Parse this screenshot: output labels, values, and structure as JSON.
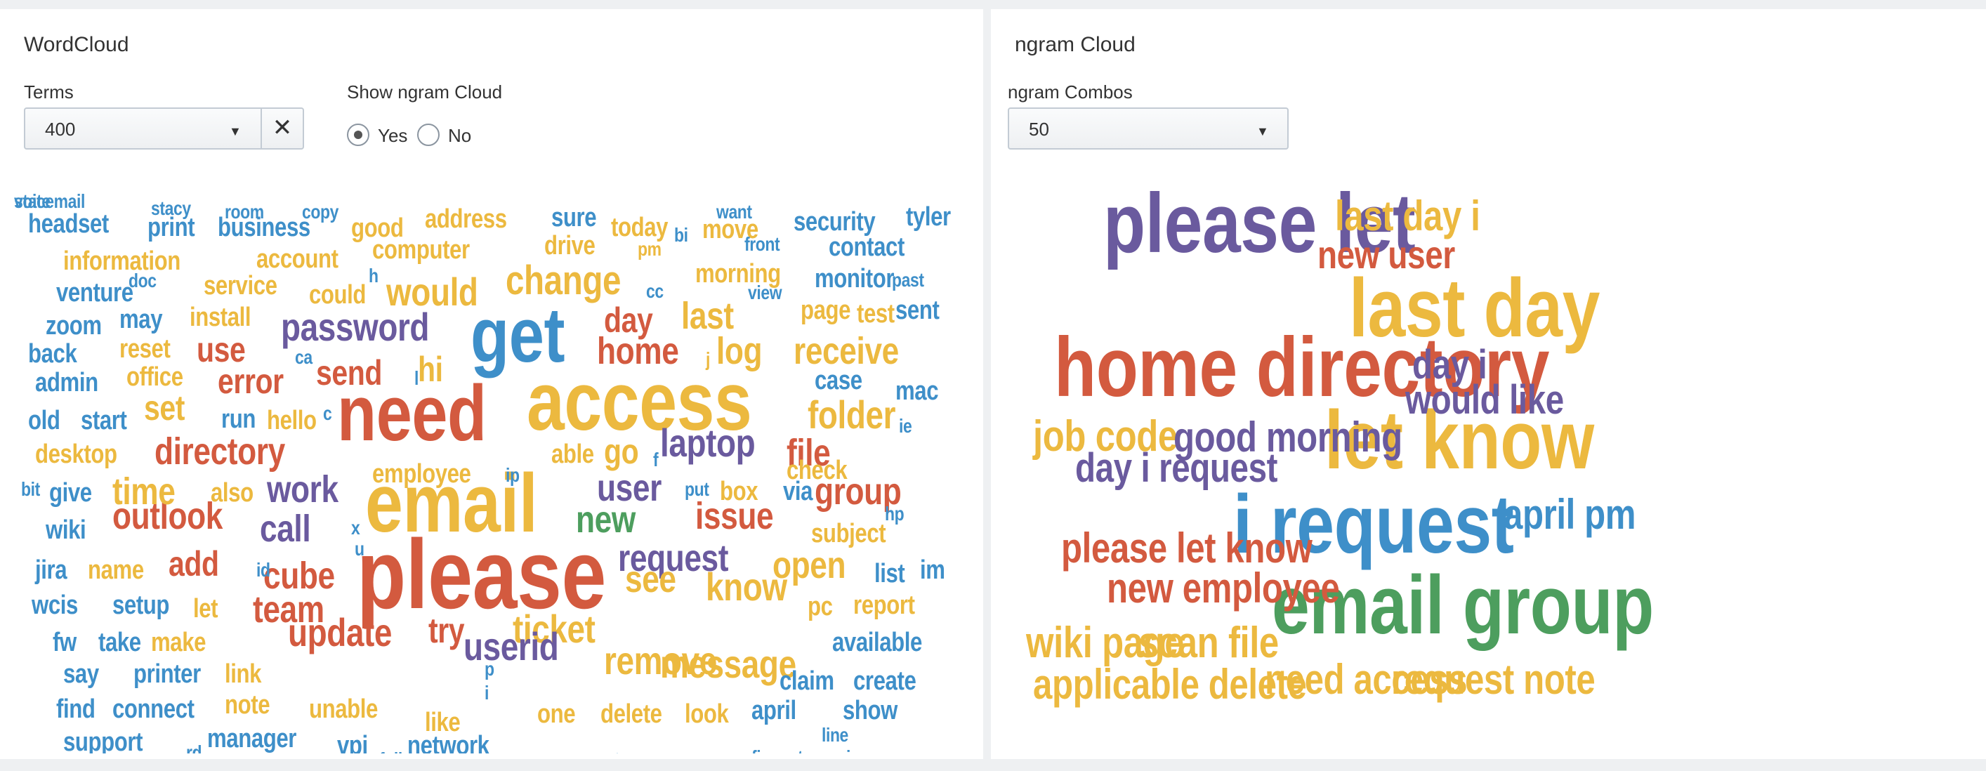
{
  "colors": {
    "blue": "#3e8fc9",
    "yellow": "#ecb93f",
    "red": "#d35a3f",
    "purple": "#6a5a9e",
    "green": "#4d9e5e"
  },
  "left_panel": {
    "title": "WordCloud",
    "terms": {
      "label": "Terms",
      "value": "400"
    },
    "show_ngram": {
      "label": "Show ngram Cloud",
      "options": [
        {
          "label": "Yes",
          "selected": true
        },
        {
          "label": "No",
          "selected": false
        }
      ]
    }
  },
  "right_panel": {
    "title": "ngram Cloud",
    "ngram_combos": {
      "label": "ngram Combos",
      "value": "50"
    }
  },
  "word_cloud": {
    "words": [
      {
        "t": "please",
        "c": "red",
        "s": 140
      },
      {
        "t": "access",
        "c": "yellow",
        "s": 118
      },
      {
        "t": "email",
        "c": "yellow",
        "s": 118
      },
      {
        "t": "need",
        "c": "red",
        "s": 112
      },
      {
        "t": "get",
        "c": "blue",
        "s": 110
      },
      {
        "t": "password",
        "c": "purple",
        "s": 56
      },
      {
        "t": "change",
        "c": "yellow",
        "s": 58
      },
      {
        "t": "would",
        "c": "yellow",
        "s": 56
      },
      {
        "t": "home",
        "c": "red",
        "s": 54
      },
      {
        "t": "receive",
        "c": "yellow",
        "s": 54
      },
      {
        "t": "folder",
        "c": "yellow",
        "s": 56
      },
      {
        "t": "directory",
        "c": "red",
        "s": 54
      },
      {
        "t": "laptop",
        "c": "purple",
        "s": 56
      },
      {
        "t": "remove",
        "c": "yellow",
        "s": 56
      },
      {
        "t": "message",
        "c": "yellow",
        "s": 56
      },
      {
        "t": "ticket",
        "c": "yellow",
        "s": 56
      },
      {
        "t": "userid",
        "c": "purple",
        "s": 56
      },
      {
        "t": "update",
        "c": "red",
        "s": 56
      },
      {
        "t": "outlook",
        "c": "red",
        "s": 54
      },
      {
        "t": "cube",
        "c": "red",
        "s": 54
      },
      {
        "t": "team",
        "c": "red",
        "s": 54
      },
      {
        "t": "time",
        "c": "yellow",
        "s": 54
      },
      {
        "t": "work",
        "c": "purple",
        "s": 54
      },
      {
        "t": "call",
        "c": "purple",
        "s": 54
      },
      {
        "t": "group",
        "c": "red",
        "s": 54
      },
      {
        "t": "issue",
        "c": "red",
        "s": 54
      },
      {
        "t": "request",
        "c": "purple",
        "s": 54
      },
      {
        "t": "know",
        "c": "yellow",
        "s": 56
      },
      {
        "t": "open",
        "c": "yellow",
        "s": 54
      },
      {
        "t": "see",
        "c": "yellow",
        "s": 54
      },
      {
        "t": "last",
        "c": "yellow",
        "s": 54
      },
      {
        "t": "log",
        "c": "yellow",
        "s": 54
      },
      {
        "t": "file",
        "c": "red",
        "s": 54
      },
      {
        "t": "user",
        "c": "purple",
        "s": 54
      },
      {
        "t": "new",
        "c": "green",
        "s": 54
      },
      {
        "t": "error",
        "c": "red",
        "s": 50
      },
      {
        "t": "send",
        "c": "red",
        "s": 50
      },
      {
        "t": "use",
        "c": "red",
        "s": 50
      },
      {
        "t": "set",
        "c": "yellow",
        "s": 50
      },
      {
        "t": "day",
        "c": "red",
        "s": 50
      },
      {
        "t": "add",
        "c": "red",
        "s": 50
      },
      {
        "t": "try",
        "c": "red",
        "s": 50
      },
      {
        "t": "go",
        "c": "yellow",
        "s": 50
      },
      {
        "t": "hi",
        "c": "yellow",
        "s": 50
      },
      {
        "t": "headset",
        "c": "blue",
        "s": 38
      },
      {
        "t": "print",
        "c": "blue",
        "s": 38
      },
      {
        "t": "business",
        "c": "blue",
        "s": 38
      },
      {
        "t": "good",
        "c": "yellow",
        "s": 38
      },
      {
        "t": "address",
        "c": "yellow",
        "s": 38
      },
      {
        "t": "sure",
        "c": "blue",
        "s": 38
      },
      {
        "t": "today",
        "c": "yellow",
        "s": 38
      },
      {
        "t": "move",
        "c": "yellow",
        "s": 38
      },
      {
        "t": "security",
        "c": "blue",
        "s": 38
      },
      {
        "t": "tyler",
        "c": "blue",
        "s": 38
      },
      {
        "t": "information",
        "c": "yellow",
        "s": 38
      },
      {
        "t": "account",
        "c": "yellow",
        "s": 38
      },
      {
        "t": "computer",
        "c": "yellow",
        "s": 38
      },
      {
        "t": "drive",
        "c": "yellow",
        "s": 38
      },
      {
        "t": "contact",
        "c": "blue",
        "s": 38
      },
      {
        "t": "venture",
        "c": "blue",
        "s": 38
      },
      {
        "t": "service",
        "c": "yellow",
        "s": 38
      },
      {
        "t": "could",
        "c": "yellow",
        "s": 38
      },
      {
        "t": "morning",
        "c": "yellow",
        "s": 38
      },
      {
        "t": "monitor",
        "c": "blue",
        "s": 38
      },
      {
        "t": "zoom",
        "c": "blue",
        "s": 38
      },
      {
        "t": "may",
        "c": "blue",
        "s": 38
      },
      {
        "t": "install",
        "c": "yellow",
        "s": 38
      },
      {
        "t": "page",
        "c": "yellow",
        "s": 38
      },
      {
        "t": "test",
        "c": "yellow",
        "s": 38
      },
      {
        "t": "sent",
        "c": "blue",
        "s": 38
      },
      {
        "t": "back",
        "c": "blue",
        "s": 38
      },
      {
        "t": "reset",
        "c": "yellow",
        "s": 38
      },
      {
        "t": "admin",
        "c": "blue",
        "s": 38
      },
      {
        "t": "office",
        "c": "yellow",
        "s": 38
      },
      {
        "t": "case",
        "c": "blue",
        "s": 38
      },
      {
        "t": "mac",
        "c": "blue",
        "s": 38
      },
      {
        "t": "old",
        "c": "blue",
        "s": 38
      },
      {
        "t": "start",
        "c": "blue",
        "s": 38
      },
      {
        "t": "run",
        "c": "blue",
        "s": 38
      },
      {
        "t": "hello",
        "c": "yellow",
        "s": 38
      },
      {
        "t": "desktop",
        "c": "yellow",
        "s": 38
      },
      {
        "t": "employee",
        "c": "yellow",
        "s": 38
      },
      {
        "t": "able",
        "c": "yellow",
        "s": 38
      },
      {
        "t": "check",
        "c": "yellow",
        "s": 38
      },
      {
        "t": "give",
        "c": "blue",
        "s": 38
      },
      {
        "t": "also",
        "c": "yellow",
        "s": 38
      },
      {
        "t": "box",
        "c": "yellow",
        "s": 38
      },
      {
        "t": "via",
        "c": "blue",
        "s": 38
      },
      {
        "t": "wiki",
        "c": "blue",
        "s": 38
      },
      {
        "t": "subject",
        "c": "yellow",
        "s": 38
      },
      {
        "t": "jira",
        "c": "blue",
        "s": 38
      },
      {
        "t": "name",
        "c": "yellow",
        "s": 38
      },
      {
        "t": "list",
        "c": "blue",
        "s": 38
      },
      {
        "t": "im",
        "c": "blue",
        "s": 38
      },
      {
        "t": "wcis",
        "c": "blue",
        "s": 38
      },
      {
        "t": "setup",
        "c": "blue",
        "s": 38
      },
      {
        "t": "let",
        "c": "yellow",
        "s": 38
      },
      {
        "t": "pc",
        "c": "yellow",
        "s": 38
      },
      {
        "t": "report",
        "c": "yellow",
        "s": 38
      },
      {
        "t": "fw",
        "c": "blue",
        "s": 38
      },
      {
        "t": "take",
        "c": "blue",
        "s": 38
      },
      {
        "t": "make",
        "c": "yellow",
        "s": 38
      },
      {
        "t": "available",
        "c": "blue",
        "s": 38
      },
      {
        "t": "say",
        "c": "blue",
        "s": 38
      },
      {
        "t": "printer",
        "c": "blue",
        "s": 38
      },
      {
        "t": "link",
        "c": "yellow",
        "s": 38
      },
      {
        "t": "note",
        "c": "yellow",
        "s": 38
      },
      {
        "t": "claim",
        "c": "blue",
        "s": 38
      },
      {
        "t": "create",
        "c": "blue",
        "s": 38
      },
      {
        "t": "find",
        "c": "blue",
        "s": 38
      },
      {
        "t": "connect",
        "c": "blue",
        "s": 38
      },
      {
        "t": "unable",
        "c": "yellow",
        "s": 38
      },
      {
        "t": "like",
        "c": "yellow",
        "s": 38
      },
      {
        "t": "one",
        "c": "yellow",
        "s": 38
      },
      {
        "t": "april",
        "c": "blue",
        "s": 38
      },
      {
        "t": "show",
        "c": "blue",
        "s": 38
      },
      {
        "t": "support",
        "c": "blue",
        "s": 38
      },
      {
        "t": "manager",
        "c": "blue",
        "s": 38
      },
      {
        "t": "vpi",
        "c": "blue",
        "s": 38
      },
      {
        "t": "network",
        "c": "blue",
        "s": 38
      },
      {
        "t": "delete",
        "c": "yellow",
        "s": 38
      },
      {
        "t": "look",
        "c": "yellow",
        "s": 38
      },
      {
        "t": "stacy",
        "c": "blue",
        "s": 28
      },
      {
        "t": "room",
        "c": "blue",
        "s": 28
      },
      {
        "t": "copy",
        "c": "blue",
        "s": 28
      },
      {
        "t": "want",
        "c": "blue",
        "s": 28
      },
      {
        "t": "bi",
        "c": "blue",
        "s": 28
      },
      {
        "t": "pm",
        "c": "yellow",
        "s": 28
      },
      {
        "t": "front",
        "c": "blue",
        "s": 28
      },
      {
        "t": "doc",
        "c": "blue",
        "s": 28
      },
      {
        "t": "h",
        "c": "blue",
        "s": 28
      },
      {
        "t": "cc",
        "c": "blue",
        "s": 28
      },
      {
        "t": "view",
        "c": "blue",
        "s": 28
      },
      {
        "t": "past",
        "c": "blue",
        "s": 28
      },
      {
        "t": "ca",
        "c": "blue",
        "s": 28
      },
      {
        "t": "j",
        "c": "yellow",
        "s": 28
      },
      {
        "t": "c",
        "c": "blue",
        "s": 28
      },
      {
        "t": "l",
        "c": "blue",
        "s": 28
      },
      {
        "t": "ie",
        "c": "blue",
        "s": 28
      },
      {
        "t": "ip",
        "c": "blue",
        "s": 28
      },
      {
        "t": "f",
        "c": "blue",
        "s": 28
      },
      {
        "t": "bit",
        "c": "blue",
        "s": 28
      },
      {
        "t": "put",
        "c": "blue",
        "s": 28
      },
      {
        "t": "hp",
        "c": "blue",
        "s": 28
      },
      {
        "t": "x",
        "c": "blue",
        "s": 28
      },
      {
        "t": "u",
        "c": "blue",
        "s": 28
      },
      {
        "t": "id",
        "c": "blue",
        "s": 28
      },
      {
        "t": "p",
        "c": "blue",
        "s": 28
      },
      {
        "t": "i",
        "c": "blue",
        "s": 28
      },
      {
        "t": "line",
        "c": "blue",
        "s": 28
      },
      {
        "t": "rd",
        "c": "blue",
        "s": 28
      },
      {
        "t": "full",
        "c": "blue",
        "s": 28
      },
      {
        "t": "two",
        "c": "blue",
        "s": 28
      },
      {
        "t": "fix",
        "c": "blue",
        "s": 28
      },
      {
        "t": "return",
        "c": "blue",
        "s": 28
      },
      {
        "t": "ive",
        "c": "blue",
        "s": 28
      },
      {
        "t": "state",
        "c": "blue",
        "s": 28
      },
      {
        "t": "voicemail",
        "c": "blue",
        "s": 28
      }
    ]
  },
  "ngram_cloud": {
    "words": [
      {
        "t": "please let",
        "c": "purple",
        "s": 120
      },
      {
        "t": "home directory",
        "c": "red",
        "s": 120
      },
      {
        "t": "last day",
        "c": "yellow",
        "s": 118
      },
      {
        "t": "let know",
        "c": "yellow",
        "s": 118
      },
      {
        "t": "i request",
        "c": "blue",
        "s": 118
      },
      {
        "t": "email group",
        "c": "green",
        "s": 118
      },
      {
        "t": "last day i",
        "c": "yellow",
        "s": 60
      },
      {
        "t": "new user",
        "c": "red",
        "s": 56
      },
      {
        "t": "day i",
        "c": "purple",
        "s": 58
      },
      {
        "t": "would like",
        "c": "purple",
        "s": 58
      },
      {
        "t": "job code",
        "c": "yellow",
        "s": 62
      },
      {
        "t": "good morning",
        "c": "purple",
        "s": 60
      },
      {
        "t": "day i request",
        "c": "purple",
        "s": 58
      },
      {
        "t": "april pm",
        "c": "blue",
        "s": 60
      },
      {
        "t": "please let know",
        "c": "red",
        "s": 60
      },
      {
        "t": "new employee",
        "c": "red",
        "s": 60
      },
      {
        "t": "wiki page",
        "c": "yellow",
        "s": 62
      },
      {
        "t": "scan file",
        "c": "yellow",
        "s": 62
      },
      {
        "t": "applicable delete",
        "c": "yellow",
        "s": 60
      },
      {
        "t": "need access",
        "c": "yellow",
        "s": 60
      },
      {
        "t": "request note",
        "c": "yellow",
        "s": 60
      }
    ]
  }
}
